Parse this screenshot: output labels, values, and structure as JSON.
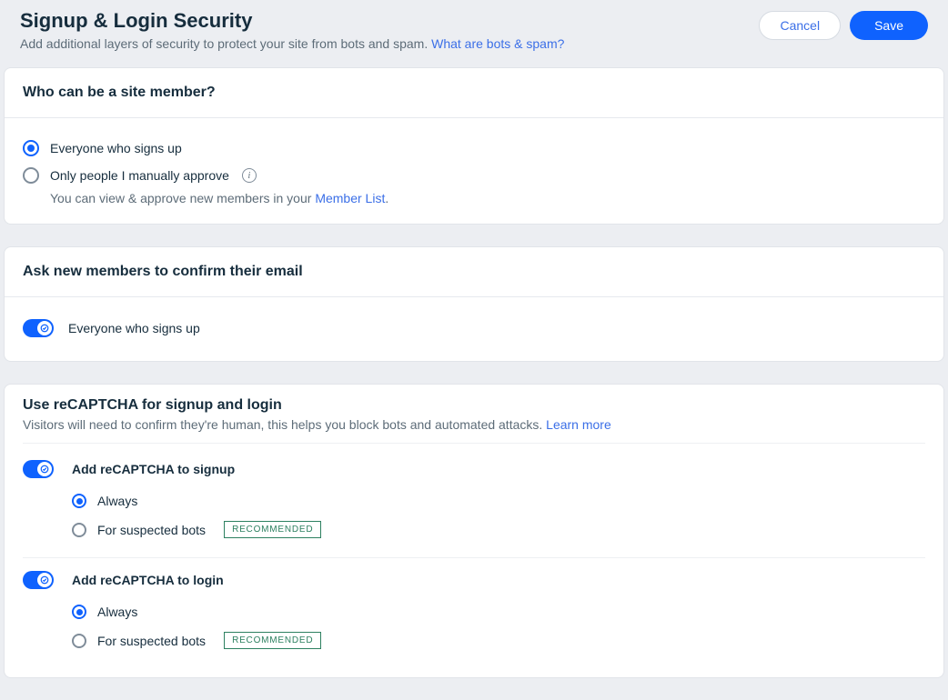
{
  "header": {
    "title": "Signup & Login Security",
    "subtitle": "Add additional layers of security to protect your site from bots and spam. ",
    "help_link": "What are bots & spam?",
    "cancel_label": "Cancel",
    "save_label": "Save"
  },
  "section_membership": {
    "title": "Who can be a site member?",
    "option_everyone": "Everyone who signs up",
    "option_manual": "Only people I manually approve",
    "help_prefix": "You can view & approve new members in your ",
    "help_link": "Member List",
    "help_suffix": "."
  },
  "section_confirm": {
    "title": "Ask new members to confirm their email",
    "toggle_label": "Everyone who signs up"
  },
  "section_recaptcha": {
    "title": "Use reCAPTCHA for signup and login",
    "desc": "Visitors will need to confirm they're human, this helps you block bots and automated attacks. ",
    "learn_more": "Learn more",
    "signup": {
      "title": "Add reCAPTCHA to signup",
      "opt_always": "Always",
      "opt_suspected": "For suspected bots",
      "tag": "RECOMMENDED"
    },
    "login": {
      "title": "Add reCAPTCHA to login",
      "opt_always": "Always",
      "opt_suspected": "For suspected bots",
      "tag": "RECOMMENDED"
    }
  },
  "info_glyph": "i"
}
